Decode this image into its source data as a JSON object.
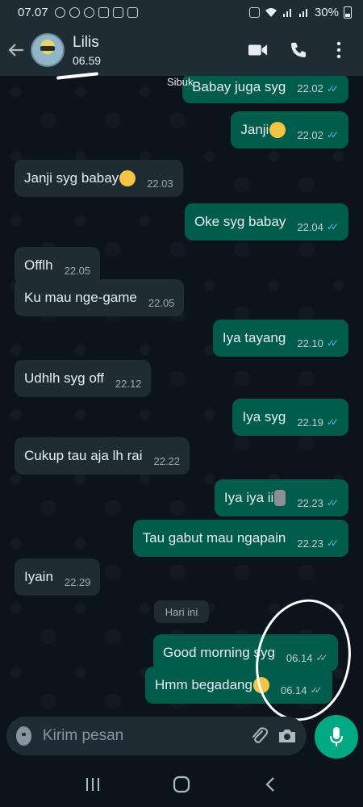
{
  "status_bar": {
    "time": "07.07",
    "battery_percent": "30%",
    "notification_icons": [
      "chat-icon",
      "chat-icon",
      "avatar-icon",
      "app-icon",
      "cat-icon",
      "image-icon"
    ]
  },
  "header": {
    "contact_name": "Lilis",
    "last_seen": "06.59",
    "status_label": "Sibuk"
  },
  "messages": [
    {
      "direction": "out",
      "text": "Babay juga syg",
      "time": "22.02",
      "status": "read"
    },
    {
      "direction": "out",
      "text": "Janji",
      "emoji": "frowning-face",
      "time": "22.02",
      "status": "read"
    },
    {
      "direction": "in",
      "text": "Janji syg babay",
      "emoji": "kissing-face",
      "time": "22.03"
    },
    {
      "direction": "out",
      "text": "Oke syg babay",
      "time": "22.04",
      "status": "read"
    },
    {
      "direction": "in",
      "text": "Offlh",
      "time": "22.05"
    },
    {
      "direction": "in",
      "text": "Ku mau nge-game",
      "time": "22.05"
    },
    {
      "direction": "out",
      "text": "Iya tayang",
      "time": "22.10",
      "status": "read"
    },
    {
      "direction": "in",
      "text": "Udhlh syg off",
      "time": "22.12"
    },
    {
      "direction": "out",
      "text": "Iya syg",
      "time": "22.19",
      "status": "read"
    },
    {
      "direction": "in",
      "text": "Cukup tau aja lh rai",
      "time": "22.22"
    },
    {
      "direction": "out",
      "text": "Iya iya ii",
      "emoji": "moai",
      "time": "22.23",
      "status": "read"
    },
    {
      "direction": "out",
      "text": "Tau gabut mau ngapain",
      "time": "22.23",
      "status": "read"
    },
    {
      "direction": "in",
      "text": "Iyain",
      "time": "22.29"
    },
    {
      "direction": "out",
      "text": "Good morning syg",
      "time": "06.14",
      "status": "delivered"
    },
    {
      "direction": "out",
      "text": "Hmm begadang",
      "emoji": "rolling-eyes",
      "time": "06.14",
      "status": "delivered"
    }
  ],
  "date_divider": "Hari ini",
  "composer": {
    "placeholder": "Kirim pesan"
  },
  "colors": {
    "header_bg": "#1f2c34",
    "chat_bg": "#0b141a",
    "outgoing_bubble": "#005c4b",
    "incoming_bubble": "#1f2c34",
    "read_tick": "#53bdeb",
    "accent": "#00a884"
  },
  "icons": {
    "back": "arrow-left-icon",
    "video": "video-call-icon",
    "call": "phone-icon",
    "menu": "more-vert-icon",
    "emoji": "emoji-icon",
    "attach": "paperclip-icon",
    "camera": "camera-icon",
    "mic": "mic-icon"
  }
}
